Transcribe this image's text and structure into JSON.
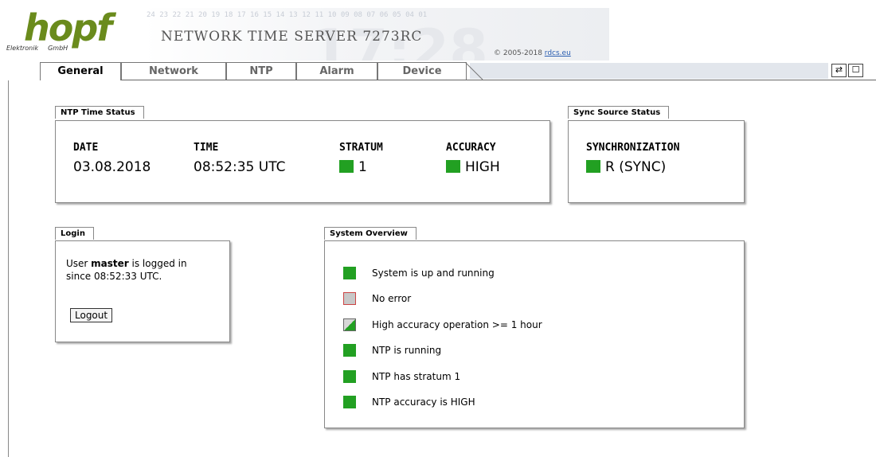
{
  "header": {
    "logo_text": "hopf",
    "logo_sub_left": "Elektronik",
    "logo_sub_right": "GmbH",
    "banner_digits": "24 23 22 21 20 19 18 17 16 15 14 13 12 11 10 09 08 07 06 05 04 01",
    "banner_big": "17:28",
    "title": "NETWORK TIME SERVER 7273RC",
    "copyright_prefix": "© 2005-2018 ",
    "copyright_link": "rdcs.eu"
  },
  "tabs": [
    {
      "label": "General",
      "active": true
    },
    {
      "label": "Network",
      "active": false
    },
    {
      "label": "NTP",
      "active": false
    },
    {
      "label": "Alarm",
      "active": false
    },
    {
      "label": "Device",
      "active": false
    }
  ],
  "window_buttons": {
    "refresh": "⇄",
    "popout": "☐"
  },
  "ntp_status": {
    "label": "NTP Time Status",
    "date_head": "DATE",
    "date_val": "03.08.2018",
    "time_head": "TIME",
    "time_val": "08:52:35 UTC",
    "stratum_head": "STRATUM",
    "stratum_val": "1",
    "accuracy_head": "ACCURACY",
    "accuracy_val": "HIGH"
  },
  "sync_status": {
    "label": "Sync Source Status",
    "head": "SYNCHRONIZATION",
    "val": "R (SYNC)"
  },
  "login": {
    "label": "Login",
    "prefix": "User ",
    "user": "master",
    "suffix": " is logged in",
    "since": "since 08:52:33 UTC.",
    "logout": "Logout"
  },
  "overview": {
    "label": "System Overview",
    "items": [
      {
        "text": "System is up and running",
        "status": "green"
      },
      {
        "text": "No error",
        "status": "grey"
      },
      {
        "text": "High accuracy operation >= 1 hour",
        "status": "half"
      },
      {
        "text": "NTP is running",
        "status": "green"
      },
      {
        "text": "NTP has stratum 1",
        "status": "green"
      },
      {
        "text": "NTP accuracy is HIGH",
        "status": "green"
      }
    ]
  },
  "colors": {
    "status_green": "#22a022",
    "logo_green": "#6a8b1c"
  }
}
